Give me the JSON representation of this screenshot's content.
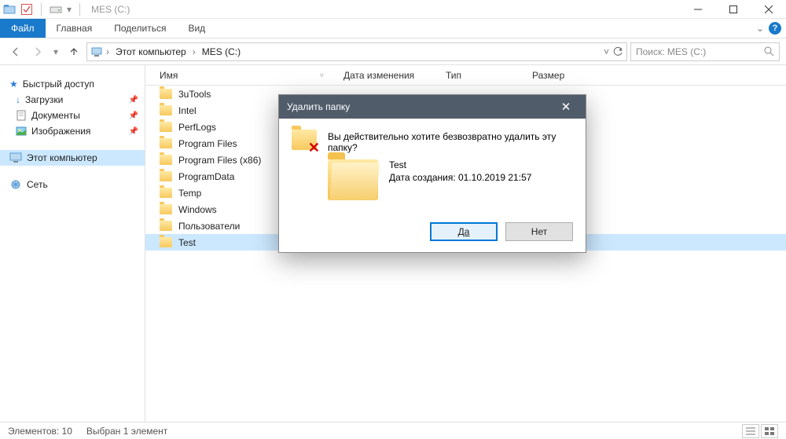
{
  "window": {
    "title": "MES (C:)"
  },
  "ribbon": {
    "file": "Файл",
    "tabs": [
      "Главная",
      "Поделиться",
      "Вид"
    ]
  },
  "breadcrumbs": [
    "Этот компьютер",
    "MES (C:)"
  ],
  "search": {
    "placeholder": "Поиск: MES (C:)"
  },
  "sidebar": {
    "quick": {
      "label": "Быстрый доступ",
      "items": [
        {
          "label": "Загрузки",
          "pinned": true
        },
        {
          "label": "Документы",
          "pinned": true
        },
        {
          "label": "Изображения",
          "pinned": true
        }
      ]
    },
    "thispc": {
      "label": "Этот компьютер",
      "selected": true
    },
    "network": {
      "label": "Сеть"
    }
  },
  "columns": {
    "name": "Имя",
    "date": "Дата изменения",
    "type": "Тип",
    "size": "Размер"
  },
  "files": [
    {
      "name": "3uTools"
    },
    {
      "name": "Intel"
    },
    {
      "name": "PerfLogs"
    },
    {
      "name": "Program Files"
    },
    {
      "name": "Program Files (x86)"
    },
    {
      "name": "ProgramData"
    },
    {
      "name": "Temp"
    },
    {
      "name": "Windows"
    },
    {
      "name": "Пользователи"
    },
    {
      "name": "Test",
      "selected": true
    }
  ],
  "status": {
    "count": "Элементов: 10",
    "selection": "Выбран 1 элемент"
  },
  "dialog": {
    "title": "Удалить папку",
    "question": "Вы действительно хотите безвозвратно удалить эту папку?",
    "item_name": "Test",
    "created": "Дата создания: 01.10.2019 21:57",
    "yes": "Да",
    "no": "Нет"
  }
}
